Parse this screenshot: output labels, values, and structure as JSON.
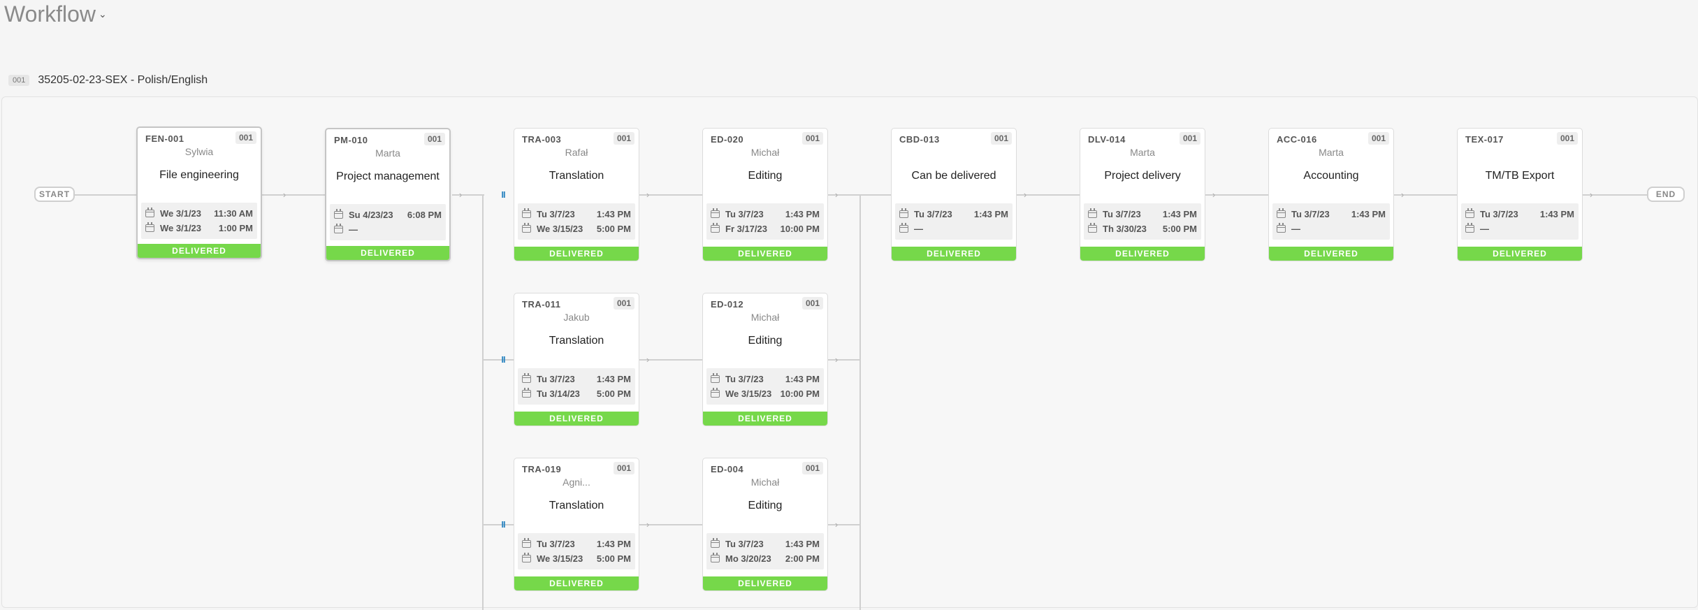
{
  "header": {
    "title": "Workflow"
  },
  "job": {
    "badge": "001",
    "name": "35205-02-23-SEX - Polish/English"
  },
  "flow": {
    "start_label": "START",
    "end_label": "END",
    "status_label": "DELIVERED"
  },
  "cards": {
    "fen": {
      "code": "FEN-001",
      "badge": "001",
      "person": "Sylwia",
      "title": "File engineering",
      "d1_day": "We 3/1/23",
      "d1_time": "11:30 AM",
      "d2_day": "We 3/1/23",
      "d2_time": "1:00 PM"
    },
    "pm": {
      "code": "PM-010",
      "badge": "001",
      "person": "Marta",
      "title": "Project management",
      "d1_day": "Su 4/23/23",
      "d1_time": "6:08 PM",
      "d2_day": "—",
      "d2_time": ""
    },
    "tra003": {
      "code": "TRA-003",
      "badge": "001",
      "person": "Rafał",
      "title": "Translation",
      "d1_day": "Tu 3/7/23",
      "d1_time": "1:43 PM",
      "d2_day": "We 3/15/23",
      "d2_time": "5:00 PM"
    },
    "ed020": {
      "code": "ED-020",
      "badge": "001",
      "person": "Michał",
      "title": "Editing",
      "d1_day": "Tu 3/7/23",
      "d1_time": "1:43 PM",
      "d2_day": "Fr 3/17/23",
      "d2_time": "10:00 PM"
    },
    "cbd": {
      "code": "CBD-013",
      "badge": "001",
      "person": "",
      "title": "Can be delivered",
      "d1_day": "Tu 3/7/23",
      "d1_time": "1:43 PM",
      "d2_day": "—",
      "d2_time": ""
    },
    "dlv": {
      "code": "DLV-014",
      "badge": "001",
      "person": "Marta",
      "title": "Project delivery",
      "d1_day": "Tu 3/7/23",
      "d1_time": "1:43 PM",
      "d2_day": "Th 3/30/23",
      "d2_time": "5:00 PM"
    },
    "acc": {
      "code": "ACC-016",
      "badge": "001",
      "person": "Marta",
      "title": "Accounting",
      "d1_day": "Tu 3/7/23",
      "d1_time": "1:43 PM",
      "d2_day": "—",
      "d2_time": ""
    },
    "tex": {
      "code": "TEX-017",
      "badge": "001",
      "person": "",
      "title": "TM/TB Export",
      "d1_day": "Tu 3/7/23",
      "d1_time": "1:43 PM",
      "d2_day": "—",
      "d2_time": ""
    },
    "tra011": {
      "code": "TRA-011",
      "badge": "001",
      "person": "Jakub",
      "title": "Translation",
      "d1_day": "Tu 3/7/23",
      "d1_time": "1:43 PM",
      "d2_day": "Tu 3/14/23",
      "d2_time": "5:00 PM"
    },
    "ed012": {
      "code": "ED-012",
      "badge": "001",
      "person": "Michał",
      "title": "Editing",
      "d1_day": "Tu 3/7/23",
      "d1_time": "1:43 PM",
      "d2_day": "We 3/15/23",
      "d2_time": "10:00 PM"
    },
    "tra019": {
      "code": "TRA-019",
      "badge": "001",
      "person": "Agni...",
      "title": "Translation",
      "d1_day": "Tu 3/7/23",
      "d1_time": "1:43 PM",
      "d2_day": "We 3/15/23",
      "d2_time": "5:00 PM"
    },
    "ed004": {
      "code": "ED-004",
      "badge": "001",
      "person": "Michał",
      "title": "Editing",
      "d1_day": "Tu 3/7/23",
      "d1_time": "1:43 PM",
      "d2_day": "Mo 3/20/23",
      "d2_time": "2:00 PM"
    }
  }
}
